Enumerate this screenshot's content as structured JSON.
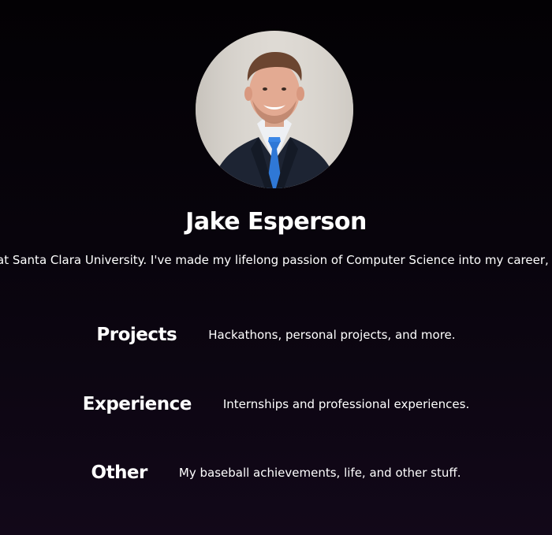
{
  "profile": {
    "name": "Jake Esperson",
    "bio": "at Santa Clara University. I've made my lifelong passion of Computer Science into my career, so fee",
    "avatar_icon": "profile-photo"
  },
  "nav": [
    {
      "title": "Projects",
      "description": "Hackathons, personal projects, and more."
    },
    {
      "title": "Experience",
      "description": "Internships and professional experiences."
    },
    {
      "title": "Other",
      "description": "My baseball achievements, life, and other stuff."
    }
  ],
  "colors": {
    "background_top": "#030104",
    "background_bottom": "#120819",
    "text": "#ffffff",
    "tie": "#2f78d6"
  }
}
